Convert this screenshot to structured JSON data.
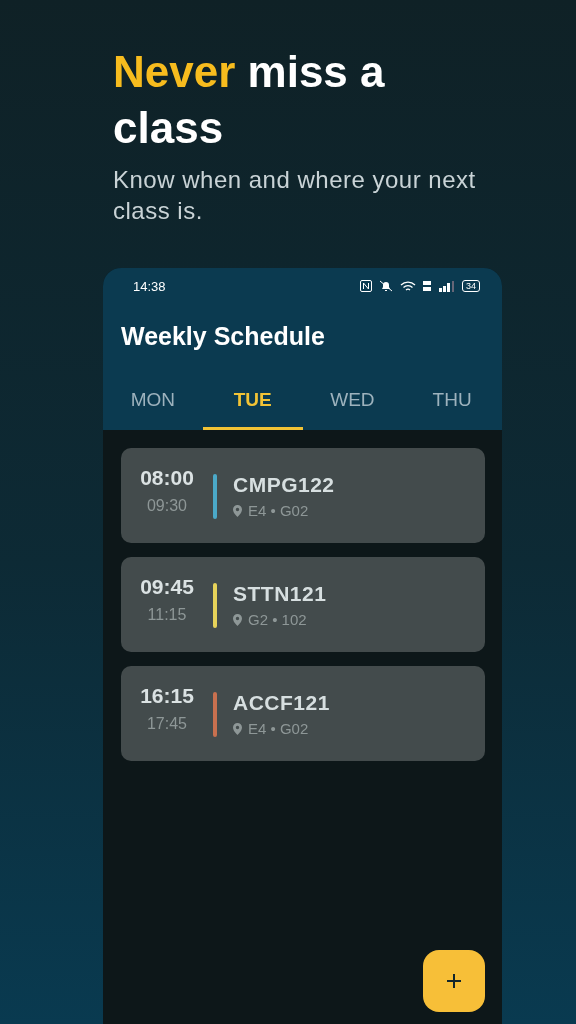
{
  "hero": {
    "highlight": "Never",
    "rest": "miss a class",
    "subtitle": "Know when and where your next class is."
  },
  "status_bar": {
    "time": "14:38",
    "battery": "34"
  },
  "app_bar": {
    "title": "Weekly Schedule"
  },
  "tabs": [
    {
      "label": "MON",
      "selected": false
    },
    {
      "label": "TUE",
      "selected": true
    },
    {
      "label": "WED",
      "selected": false
    },
    {
      "label": "THU",
      "selected": false
    }
  ],
  "classes": [
    {
      "start": "08:00",
      "end": "09:30",
      "code": "CMPG122",
      "location": "E4 • G02",
      "color": "#4ba9c8"
    },
    {
      "start": "09:45",
      "end": "11:15",
      "code": "STTN121",
      "location": "G2 • 102",
      "color": "#e7d35a"
    },
    {
      "start": "16:15",
      "end": "17:45",
      "code": "ACCF121",
      "location": "E4 • G02",
      "color": "#c8704f"
    }
  ]
}
